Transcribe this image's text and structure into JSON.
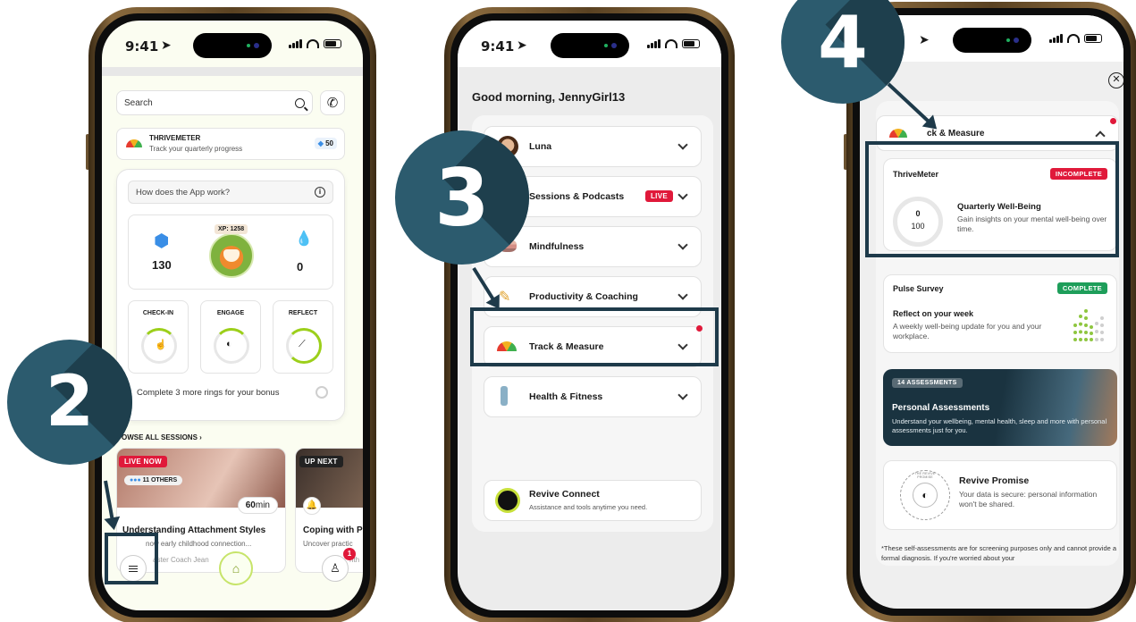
{
  "status_bar": {
    "time": "9:41"
  },
  "steps": {
    "two": "2",
    "three": "3",
    "four": "4"
  },
  "phone1": {
    "search_placeholder": "Search",
    "thrivemeter": {
      "title": "THRIVEMETER",
      "subtitle": "Track your quarterly progress",
      "points": "50"
    },
    "faq": "How does the App work?",
    "xp": {
      "xp_label": "XP: 1258",
      "gems": "130",
      "drops": "0"
    },
    "rings": [
      {
        "label": "CHECK-IN"
      },
      {
        "label": "ENGAGE"
      },
      {
        "label": "REFLECT"
      }
    ],
    "bonus_text": "Complete 3 more rings for your bonus",
    "browse_label": "OWSE ALL SESSIONS",
    "session1": {
      "badge": "LIVE NOW",
      "others": "11 OTHERS",
      "duration": "60",
      "duration_unit": "min",
      "title": "Understanding Attachment Styles",
      "desc": "now early childhood connection...",
      "coach": "aster Coach Jean"
    },
    "session2": {
      "badge": "UP NEXT",
      "title": "Coping with P",
      "desc": "Uncover practic",
      "coach": "nth"
    },
    "notification_count": "1"
  },
  "phone2": {
    "greeting": "Good morning, JennyGirl13",
    "menu": [
      {
        "label": "Luna"
      },
      {
        "label": "Sessions & Podcasts",
        "tag": "LIVE"
      },
      {
        "label": "Mindfulness"
      },
      {
        "label": "Productivity & Coaching"
      },
      {
        "label": "Track & Measure"
      },
      {
        "label": "Health & Fitness"
      }
    ],
    "connect": {
      "title": "Revive Connect",
      "subtitle": "Assistance and tools anytime you need."
    }
  },
  "phone3": {
    "section_title": "ck & Measure",
    "thrivemeter": {
      "title": "ThriveMeter",
      "status": "INCOMPLETE",
      "score": "0",
      "score_max": "100",
      "heading": "Quarterly Well-Being",
      "desc": "Gain insights on your mental well-being over time."
    },
    "pulse": {
      "title": "Pulse Survey",
      "status": "COMPLETE",
      "heading": "Reflect on your week",
      "desc": "A weekly well-being update for you and your workplace."
    },
    "assessments": {
      "count": "14 ASSESSMENTS",
      "title": "Personal Assessments",
      "desc": "Understand your wellbeing, mental health, sleep and more with personal assessments just for you."
    },
    "promise": {
      "seal_text": "THE REVIVE PROMISE",
      "title": "Revive Promise",
      "desc": "Your data is secure: personal information won't be shared."
    },
    "disclaimer": "*These self-assessments are for screening purposes only and cannot provide a formal diagnosis. If you're worried about your"
  },
  "colors": {
    "accent_red": "#e0193a",
    "accent_green": "#1e9e5a",
    "lime": "#9ccf1a",
    "badge_teal": "#2c5b6e",
    "badge_dark": "#1e3a4a"
  }
}
